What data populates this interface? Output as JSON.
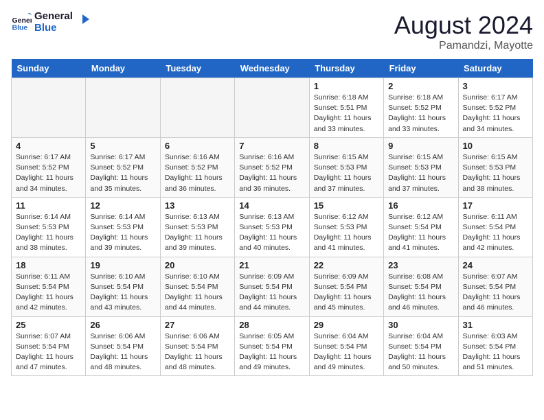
{
  "logo": {
    "text_general": "General",
    "text_blue": "Blue"
  },
  "title": {
    "month_year": "August 2024",
    "location": "Pamandzi, Mayotte"
  },
  "days_of_week": [
    "Sunday",
    "Monday",
    "Tuesday",
    "Wednesday",
    "Thursday",
    "Friday",
    "Saturday"
  ],
  "weeks": [
    {
      "days": [
        {
          "num": "",
          "empty": true
        },
        {
          "num": "",
          "empty": true
        },
        {
          "num": "",
          "empty": true
        },
        {
          "num": "",
          "empty": true
        },
        {
          "num": "1",
          "sunrise": "6:18 AM",
          "sunset": "5:51 PM",
          "daylight": "Daylight: 11 hours and 33 minutes."
        },
        {
          "num": "2",
          "sunrise": "6:18 AM",
          "sunset": "5:52 PM",
          "daylight": "Daylight: 11 hours and 33 minutes."
        },
        {
          "num": "3",
          "sunrise": "6:17 AM",
          "sunset": "5:52 PM",
          "daylight": "Daylight: 11 hours and 34 minutes."
        }
      ]
    },
    {
      "days": [
        {
          "num": "4",
          "sunrise": "6:17 AM",
          "sunset": "5:52 PM",
          "daylight": "Daylight: 11 hours and 34 minutes."
        },
        {
          "num": "5",
          "sunrise": "6:17 AM",
          "sunset": "5:52 PM",
          "daylight": "Daylight: 11 hours and 35 minutes."
        },
        {
          "num": "6",
          "sunrise": "6:16 AM",
          "sunset": "5:52 PM",
          "daylight": "Daylight: 11 hours and 36 minutes."
        },
        {
          "num": "7",
          "sunrise": "6:16 AM",
          "sunset": "5:52 PM",
          "daylight": "Daylight: 11 hours and 36 minutes."
        },
        {
          "num": "8",
          "sunrise": "6:15 AM",
          "sunset": "5:53 PM",
          "daylight": "Daylight: 11 hours and 37 minutes."
        },
        {
          "num": "9",
          "sunrise": "6:15 AM",
          "sunset": "5:53 PM",
          "daylight": "Daylight: 11 hours and 37 minutes."
        },
        {
          "num": "10",
          "sunrise": "6:15 AM",
          "sunset": "5:53 PM",
          "daylight": "Daylight: 11 hours and 38 minutes."
        }
      ]
    },
    {
      "days": [
        {
          "num": "11",
          "sunrise": "6:14 AM",
          "sunset": "5:53 PM",
          "daylight": "Daylight: 11 hours and 38 minutes."
        },
        {
          "num": "12",
          "sunrise": "6:14 AM",
          "sunset": "5:53 PM",
          "daylight": "Daylight: 11 hours and 39 minutes."
        },
        {
          "num": "13",
          "sunrise": "6:13 AM",
          "sunset": "5:53 PM",
          "daylight": "Daylight: 11 hours and 39 minutes."
        },
        {
          "num": "14",
          "sunrise": "6:13 AM",
          "sunset": "5:53 PM",
          "daylight": "Daylight: 11 hours and 40 minutes."
        },
        {
          "num": "15",
          "sunrise": "6:12 AM",
          "sunset": "5:53 PM",
          "daylight": "Daylight: 11 hours and 41 minutes."
        },
        {
          "num": "16",
          "sunrise": "6:12 AM",
          "sunset": "5:54 PM",
          "daylight": "Daylight: 11 hours and 41 minutes."
        },
        {
          "num": "17",
          "sunrise": "6:11 AM",
          "sunset": "5:54 PM",
          "daylight": "Daylight: 11 hours and 42 minutes."
        }
      ]
    },
    {
      "days": [
        {
          "num": "18",
          "sunrise": "6:11 AM",
          "sunset": "5:54 PM",
          "daylight": "Daylight: 11 hours and 42 minutes."
        },
        {
          "num": "19",
          "sunrise": "6:10 AM",
          "sunset": "5:54 PM",
          "daylight": "Daylight: 11 hours and 43 minutes."
        },
        {
          "num": "20",
          "sunrise": "6:10 AM",
          "sunset": "5:54 PM",
          "daylight": "Daylight: 11 hours and 44 minutes."
        },
        {
          "num": "21",
          "sunrise": "6:09 AM",
          "sunset": "5:54 PM",
          "daylight": "Daylight: 11 hours and 44 minutes."
        },
        {
          "num": "22",
          "sunrise": "6:09 AM",
          "sunset": "5:54 PM",
          "daylight": "Daylight: 11 hours and 45 minutes."
        },
        {
          "num": "23",
          "sunrise": "6:08 AM",
          "sunset": "5:54 PM",
          "daylight": "Daylight: 11 hours and 46 minutes."
        },
        {
          "num": "24",
          "sunrise": "6:07 AM",
          "sunset": "5:54 PM",
          "daylight": "Daylight: 11 hours and 46 minutes."
        }
      ]
    },
    {
      "days": [
        {
          "num": "25",
          "sunrise": "6:07 AM",
          "sunset": "5:54 PM",
          "daylight": "Daylight: 11 hours and 47 minutes."
        },
        {
          "num": "26",
          "sunrise": "6:06 AM",
          "sunset": "5:54 PM",
          "daylight": "Daylight: 11 hours and 48 minutes."
        },
        {
          "num": "27",
          "sunrise": "6:06 AM",
          "sunset": "5:54 PM",
          "daylight": "Daylight: 11 hours and 48 minutes."
        },
        {
          "num": "28",
          "sunrise": "6:05 AM",
          "sunset": "5:54 PM",
          "daylight": "Daylight: 11 hours and 49 minutes."
        },
        {
          "num": "29",
          "sunrise": "6:04 AM",
          "sunset": "5:54 PM",
          "daylight": "Daylight: 11 hours and 49 minutes."
        },
        {
          "num": "30",
          "sunrise": "6:04 AM",
          "sunset": "5:54 PM",
          "daylight": "Daylight: 11 hours and 50 minutes."
        },
        {
          "num": "31",
          "sunrise": "6:03 AM",
          "sunset": "5:54 PM",
          "daylight": "Daylight: 11 hours and 51 minutes."
        }
      ]
    }
  ],
  "labels": {
    "sunrise_prefix": "Sunrise: ",
    "sunset_prefix": "Sunset: "
  }
}
